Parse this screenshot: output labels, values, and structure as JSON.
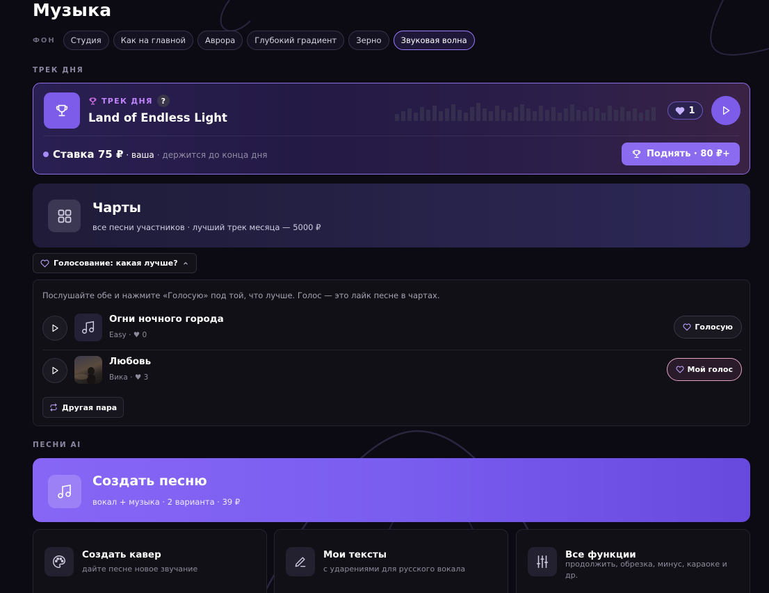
{
  "page": {
    "title": "Музыка"
  },
  "background": {
    "label": "ФОН",
    "options": [
      "Студия",
      "Как на главной",
      "Аврора",
      "Глубокий градиент",
      "Зерно",
      "Звуковая волна"
    ],
    "selected": "Звуковая волна"
  },
  "track_of_day": {
    "section_label": "ТРЕК ДНЯ",
    "kicker": "ТРЕК ДНЯ",
    "help_glyph": "?",
    "name": "Land of Endless Light",
    "likes": "1",
    "bid_label": "Ставка 75 ₽",
    "bid_owner": "· ваша",
    "bid_note": "· держится до конца дня",
    "raise_button": "Поднять · 80 ₽+"
  },
  "charts": {
    "title": "Чарты",
    "subtitle": "все песни участников · лучший трек месяца — 5000 ₽"
  },
  "vote": {
    "toggle_label": "Голосование: какая лучше?",
    "hint": "Послушайте обе и нажмите «Голосую» под той, что лучше. Голос — это лайк песне в чартах.",
    "songs": [
      {
        "title": "Огни ночного города",
        "meta": "Easy · ♥ 0",
        "button": "Голосую",
        "is_mine": false
      },
      {
        "title": "Любовь",
        "meta": "Вика · ♥ 3",
        "button": "Мой голос",
        "is_mine": true
      }
    ],
    "other_pair": "Другая пара"
  },
  "ai_songs": {
    "section_label": "ПЕСНИ AI",
    "create_title": "Создать песню",
    "create_sub": "вокал + музыка · 2 варианта · 39 ₽",
    "features": [
      {
        "title": "Создать кавер",
        "sub": "дайте песне новое звучание",
        "icon": "palette-icon"
      },
      {
        "title": "Мои тексты",
        "sub": "с ударениями для русского вокала",
        "icon": "pen-icon"
      },
      {
        "title": "Все функции",
        "sub": "продолжить, обрезка, минус, караоке и др.",
        "icon": "sliders-icon"
      }
    ]
  },
  "colors": {
    "accent": "#7c5ce9",
    "background": "#0c0a12",
    "kicker": "#c084fc"
  }
}
